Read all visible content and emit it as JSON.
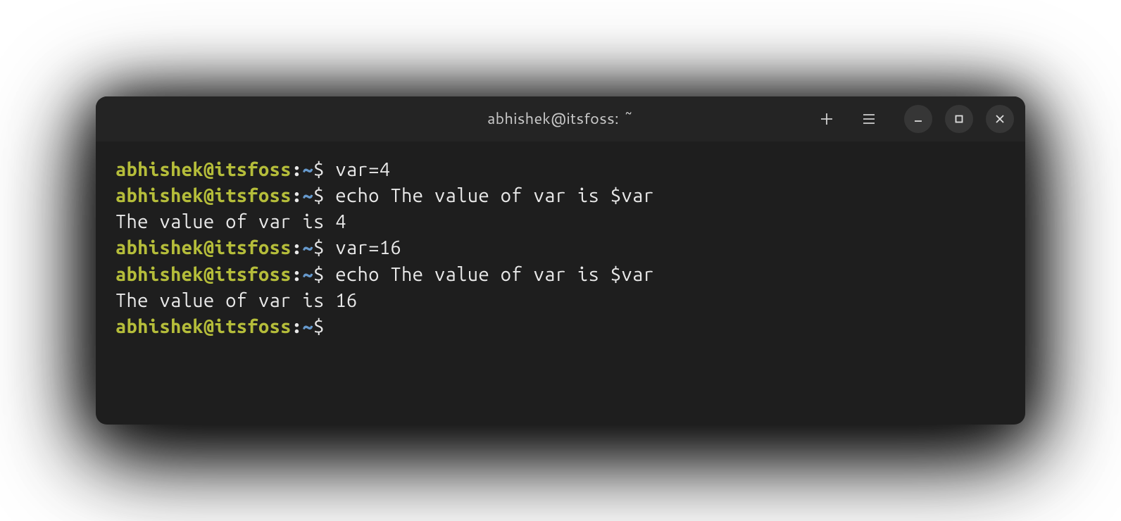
{
  "window": {
    "title": "abhishek@itsfoss: ~"
  },
  "prompt": {
    "user_host": "abhishek@itsfoss",
    "colon": ":",
    "path": "~",
    "dollar": "$ "
  },
  "terminal": {
    "lines": [
      {
        "type": "cmd",
        "text": "var=4"
      },
      {
        "type": "cmd",
        "text": "echo The value of var is $var"
      },
      {
        "type": "out",
        "text": "The value of var is 4"
      },
      {
        "type": "cmd",
        "text": "var=16"
      },
      {
        "type": "cmd",
        "text": "echo The value of var is $var"
      },
      {
        "type": "out",
        "text": "The value of var is 16"
      },
      {
        "type": "cmd",
        "text": ""
      }
    ]
  },
  "icons": {
    "new_tab": "plus-icon",
    "menu": "hamburger-icon",
    "minimize": "minimize-icon",
    "maximize": "maximize-icon",
    "close": "close-icon"
  }
}
